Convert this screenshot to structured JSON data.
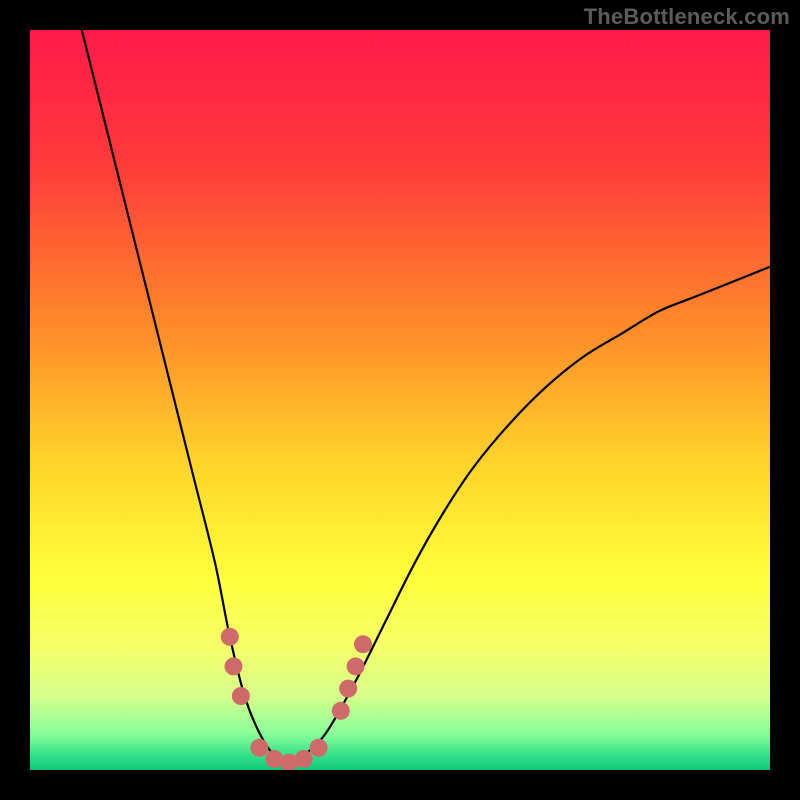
{
  "watermark": "TheBottleneck.com",
  "chart_data": {
    "type": "line",
    "title": "",
    "xlabel": "",
    "ylabel": "",
    "xlim": [
      0,
      100
    ],
    "ylim": [
      0,
      100
    ],
    "grid": false,
    "legend": false,
    "background_gradient_stops": [
      {
        "offset": 0.0,
        "color": "#ff1a4b"
      },
      {
        "offset": 0.18,
        "color": "#ff3a3a"
      },
      {
        "offset": 0.4,
        "color": "#ff8a2a"
      },
      {
        "offset": 0.58,
        "color": "#ffd22a"
      },
      {
        "offset": 0.74,
        "color": "#ffff3a"
      },
      {
        "offset": 0.83,
        "color": "#f6ff66"
      },
      {
        "offset": 0.9,
        "color": "#d6ff8a"
      },
      {
        "offset": 0.95,
        "color": "#8aff9a"
      },
      {
        "offset": 0.98,
        "color": "#35e08a"
      },
      {
        "offset": 1.0,
        "color": "#10c878"
      }
    ],
    "series": [
      {
        "name": "bottleneck-curve",
        "x": [
          7,
          10,
          13,
          16,
          19,
          22,
          25,
          27,
          29,
          31,
          33,
          35,
          37,
          40,
          44,
          48,
          52,
          56,
          60,
          65,
          70,
          75,
          80,
          85,
          90,
          95,
          100
        ],
        "y": [
          100,
          88,
          76,
          64,
          52,
          40,
          28,
          18,
          10,
          5,
          2,
          1,
          2,
          5,
          12,
          20,
          28,
          35,
          41,
          47,
          52,
          56,
          59,
          62,
          64,
          66,
          68
        ]
      }
    ],
    "highlight_points": {
      "name": "markers",
      "color": "#cf6a6a",
      "radius_px": 9,
      "points": [
        {
          "x": 27.0,
          "y": 18
        },
        {
          "x": 27.5,
          "y": 14
        },
        {
          "x": 28.5,
          "y": 10
        },
        {
          "x": 31.0,
          "y": 3
        },
        {
          "x": 33.0,
          "y": 1.5
        },
        {
          "x": 35.0,
          "y": 1
        },
        {
          "x": 37.0,
          "y": 1.5
        },
        {
          "x": 39.0,
          "y": 3
        },
        {
          "x": 42.0,
          "y": 8
        },
        {
          "x": 43.0,
          "y": 11
        },
        {
          "x": 44.0,
          "y": 14
        },
        {
          "x": 45.0,
          "y": 17
        }
      ]
    }
  }
}
